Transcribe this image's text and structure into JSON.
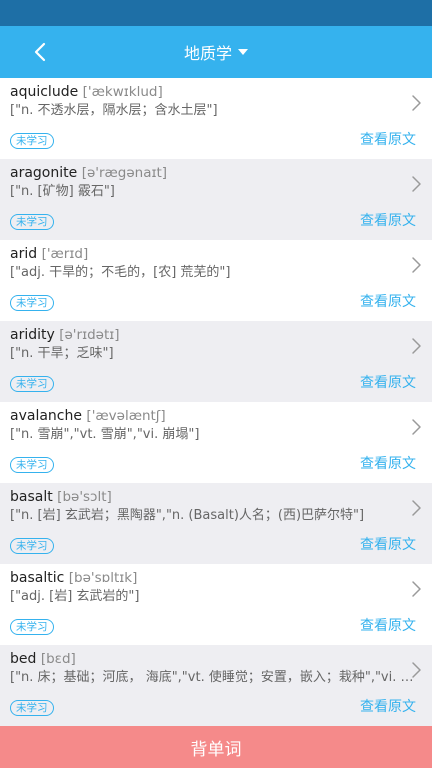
{
  "header": {
    "title": "地质学",
    "back_icon": "chevron-left-icon",
    "dropdown_icon": "caret-down-icon"
  },
  "words": [
    {
      "word": "aquiclude",
      "phonetic": "['ækwɪklud]",
      "meaning": "[\"n. 不透水层，隔水层；含水土层\"]",
      "status": "未学习",
      "link": "查看原文"
    },
    {
      "word": "aragonite",
      "phonetic": "[ə'rægənaɪt]",
      "meaning": "[\"n. [矿物] 霰石\"]",
      "status": "未学习",
      "link": "查看原文"
    },
    {
      "word": "arid",
      "phonetic": "['ærɪd]",
      "meaning": "[\"adj. 干旱的；不毛的，[农] 荒芜的\"]",
      "status": "未学习",
      "link": "查看原文"
    },
    {
      "word": "aridity",
      "phonetic": "[ə'rɪdətɪ]",
      "meaning": "[\"n. 干旱；乏味\"]",
      "status": "未学习",
      "link": "查看原文"
    },
    {
      "word": "avalanche",
      "phonetic": "['ævəlæntʃ]",
      "meaning": "[\"n. 雪崩\",\"vt. 雪崩\",\"vi. 崩塌\"]",
      "status": "未学习",
      "link": "查看原文"
    },
    {
      "word": "basalt",
      "phonetic": "[bə'sɔlt]",
      "meaning": "[\"n. [岩] 玄武岩；黑陶器\",\"n. (Basalt)人名；(西)巴萨尔特\"]",
      "status": "未学习",
      "link": "查看原文"
    },
    {
      "word": "basaltic",
      "phonetic": "[bə'sɒltɪk]",
      "meaning": "[\"adj. [岩] 玄武岩的\"]",
      "status": "未学习",
      "link": "查看原文"
    },
    {
      "word": "bed",
      "phonetic": "[bɛd]",
      "meaning": "[\"n. 床；基础；河底， 海底\",\"vt. 使睡觉；安置，嵌入；栽种\",\"vi. 睡觉\"]",
      "status": "未学习",
      "link": "查看原文"
    }
  ],
  "footer": {
    "button_label": "背单词"
  },
  "colors": {
    "accent": "#35b2ee",
    "status_bar": "#1e6fa6",
    "footer_button": "#f58a8a",
    "alt_row": "#eeeef2"
  }
}
